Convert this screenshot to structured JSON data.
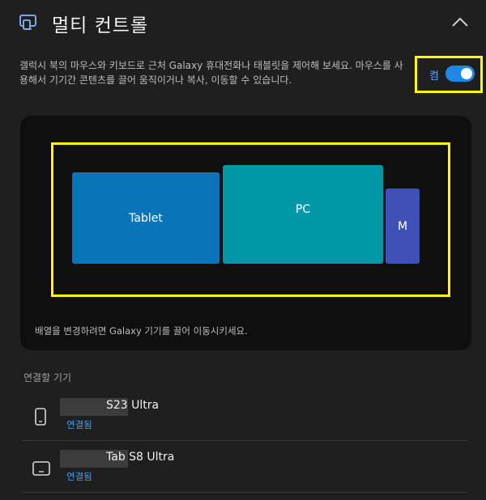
{
  "header": {
    "title": "멀티 컨트롤",
    "icon": "multi-device-icon",
    "collapse_icon": "chevron-up-icon"
  },
  "description": "갤럭시 북의 마우스와 키보드로 근처 Galaxy 휴대전화나 태블릿을 제어해 보세요. 마우스를 사용해서 기기간 콘텐츠를 끌어 움직이거나 복사, 이동할 수 있습니다.",
  "toggle": {
    "state_label": "켬",
    "on": true,
    "color": "#1e88e5"
  },
  "arrangement": {
    "devices": [
      {
        "label": "Tablet",
        "color": "#0a74b8"
      },
      {
        "label": "PC",
        "color": "#0097a7"
      },
      {
        "label": "M",
        "color": "#3f51b5"
      }
    ],
    "hint": "배열을 변경하려면 Galaxy 기기를 끌어 이동시키세요."
  },
  "connected": {
    "label": "연결할 기기",
    "items": [
      {
        "name": "S23 Ultra",
        "status": "연결됨",
        "icon": "phone-icon"
      },
      {
        "name": "Tab S8 Ultra",
        "status": "연결됨",
        "icon": "tablet-icon"
      }
    ]
  }
}
